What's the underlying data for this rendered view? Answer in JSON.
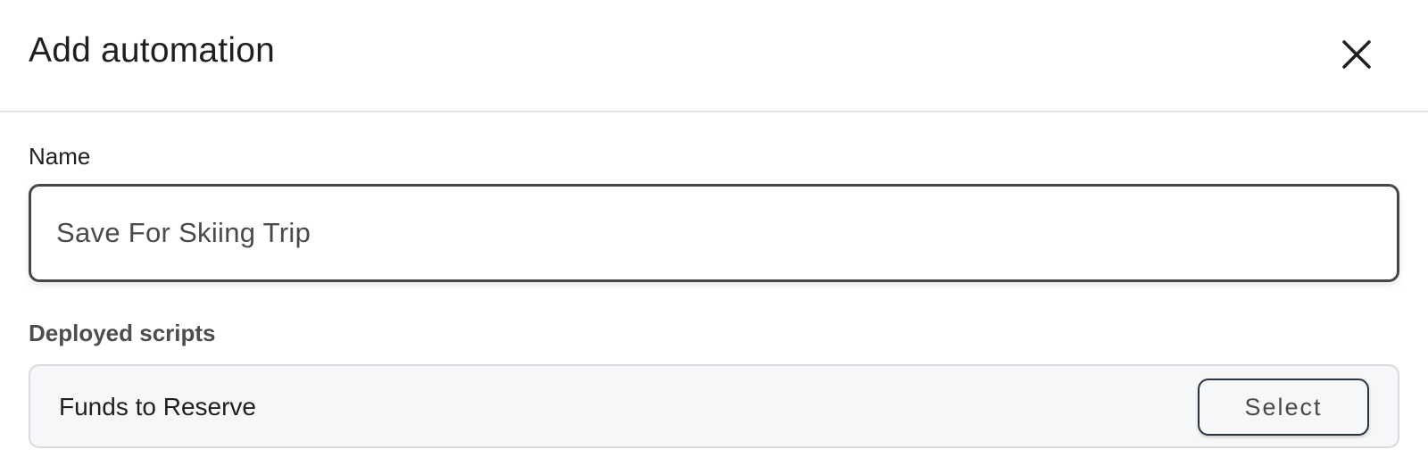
{
  "modal": {
    "title": "Add automation",
    "close_icon": "close-icon"
  },
  "name_field": {
    "label": "Name",
    "value": "Save For Skiing Trip"
  },
  "deployed_scripts": {
    "label": "Deployed scripts",
    "items": [
      {
        "name": "Funds to Reserve",
        "action_label": "Select"
      }
    ]
  },
  "colors": {
    "border_focus": "#474747",
    "row_background": "#f6f7f9",
    "button_border": "#2b3340"
  }
}
